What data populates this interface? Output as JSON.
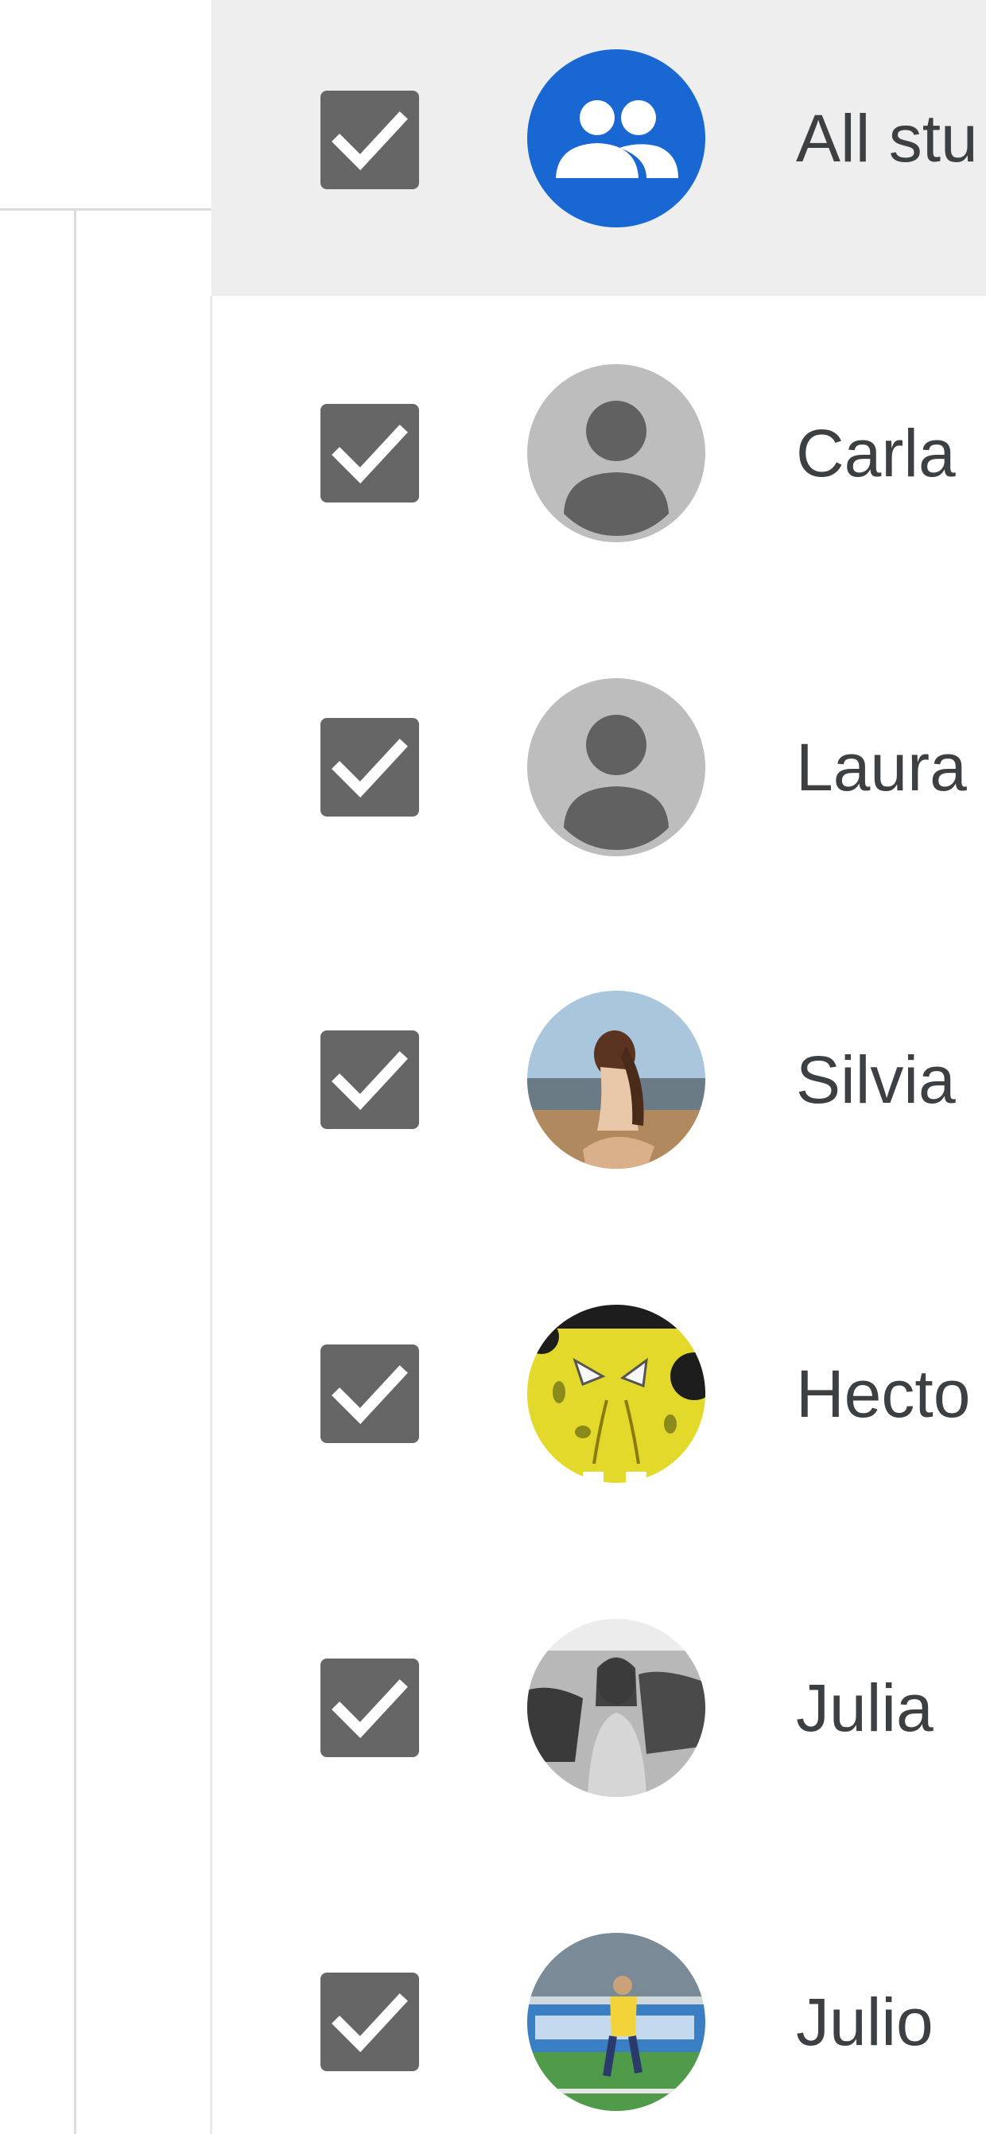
{
  "students": {
    "all_item": {
      "label": "All stu",
      "checked": true,
      "icon": "group-icon",
      "avatar_color": "#1967d2"
    },
    "items": [
      {
        "label": "Carla",
        "checked": true,
        "avatar": "default-person-icon"
      },
      {
        "label": "Laura",
        "checked": true,
        "avatar": "default-person-icon"
      },
      {
        "label": "Silvia",
        "checked": true,
        "avatar": "photo"
      },
      {
        "label": "Hecto",
        "checked": true,
        "avatar": "photo"
      },
      {
        "label": "Julia",
        "checked": true,
        "avatar": "photo"
      },
      {
        "label": "Julio",
        "checked": true,
        "avatar": "photo"
      }
    ]
  },
  "colors": {
    "checkbox": "#666666",
    "accent": "#1967d2",
    "selected_row": "#eeeeee",
    "text": "#3c4043"
  }
}
